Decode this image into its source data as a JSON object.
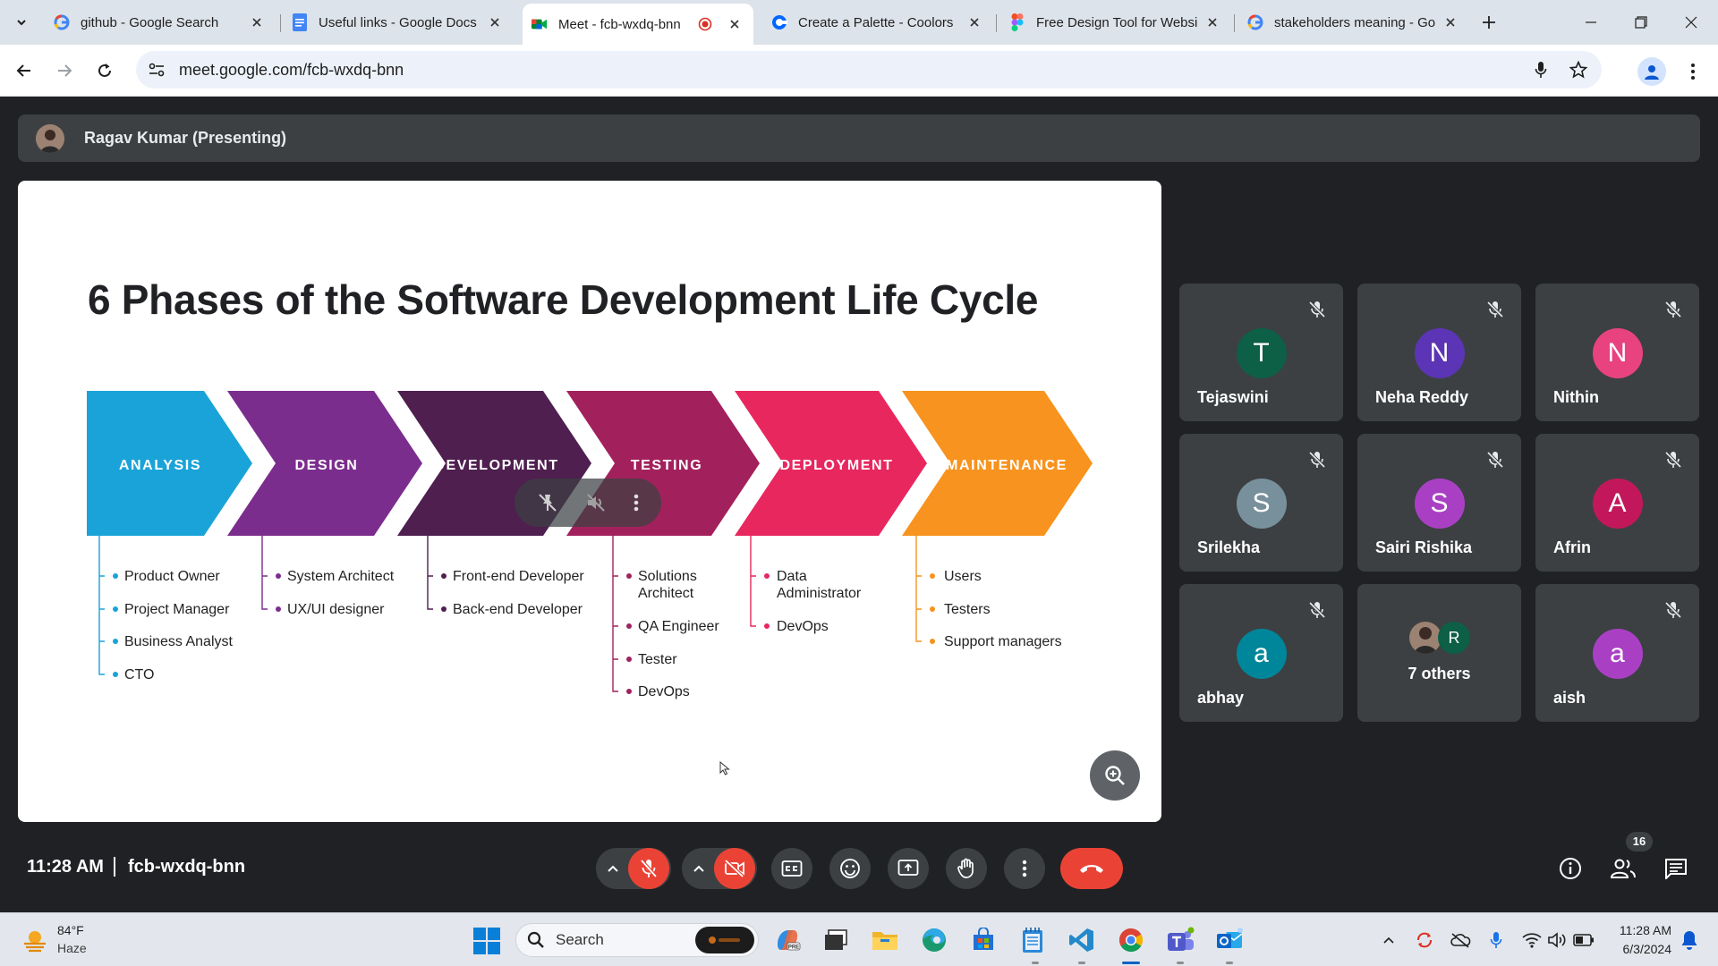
{
  "browser": {
    "tabs": [
      {
        "title": "github - Google Search",
        "favicon": "google-g-icon",
        "active": false
      },
      {
        "title": "Useful links - Google Docs",
        "favicon": "google-docs-icon",
        "active": false
      },
      {
        "title": "Meet - fcb-wxdq-bnn",
        "favicon": "google-meet-icon",
        "active": true,
        "recording": true
      },
      {
        "title": "Create a Palette - Coolors",
        "favicon": "coolors-icon",
        "active": false
      },
      {
        "title": "Free Design Tool for Websi",
        "favicon": "figma-icon",
        "active": false
      },
      {
        "title": "stakeholders meaning - Go",
        "favicon": "google-g-icon",
        "active": false
      }
    ],
    "url": "meet.google.com/fcb-wxdq-bnn"
  },
  "meet": {
    "presenter_label": "Ragav Kumar (Presenting)",
    "slide": {
      "title": "6 Phases of the Software Development Life Cycle",
      "phases": [
        {
          "label": "ANALYSIS",
          "color": "#1aa3d8",
          "roles": [
            "Product Owner",
            "Project Manager",
            "Business Analyst",
            "CTO"
          ]
        },
        {
          "label": "DESIGN",
          "color": "#7b2d8e",
          "roles": [
            "System Architect",
            "UX/UI designer"
          ]
        },
        {
          "label": "DEVELOPMENT",
          "color": "#4e1f4f",
          "roles": [
            "Front-end Developer",
            "Back-end Developer"
          ]
        },
        {
          "label": "TESTING",
          "color": "#a2215c",
          "roles": [
            "Solutions Architect",
            "QA Engineer",
            "Tester",
            "DevOps"
          ]
        },
        {
          "label": "DEPLOYMENT",
          "color": "#e8275f",
          "roles": [
            "Data Administrator",
            "DevOps"
          ]
        },
        {
          "label": "MAINTENANCE",
          "color": "#f7931e",
          "roles": [
            "Users",
            "Testers",
            "Support managers"
          ]
        }
      ]
    },
    "participants": [
      {
        "name": "Tejaswini",
        "initial": "T",
        "color": "#0d5f46",
        "muted": true
      },
      {
        "name": "Neha Reddy",
        "initial": "N",
        "color": "#5b35b5",
        "muted": true
      },
      {
        "name": "Nithin",
        "initial": "N",
        "color": "#e8437f",
        "muted": true
      },
      {
        "name": "Srilekha",
        "initial": "S",
        "color": "#78909c",
        "muted": true
      },
      {
        "name": "Sairi Rishika",
        "initial": "S",
        "color": "#a940c4",
        "muted": true
      },
      {
        "name": "Afrin",
        "initial": "A",
        "color": "#c2185b",
        "muted": true
      },
      {
        "name": "abhay",
        "initial": "a",
        "color": "#00869a",
        "muted": true
      },
      {
        "name": "7 others",
        "initial": "R",
        "color": "#0d5f46",
        "muted": false,
        "group": true
      },
      {
        "name": "aish",
        "initial": "a",
        "color": "#a940c4",
        "muted": true
      }
    ],
    "time": "11:28 AM",
    "meeting_code": "fcb-wxdq-bnn",
    "people_count": "16"
  },
  "taskbar": {
    "weather_temp": "84°F",
    "weather_condition": "Haze",
    "search_label": "Search",
    "clock_time": "11:28 AM",
    "clock_date": "6/3/2024"
  }
}
